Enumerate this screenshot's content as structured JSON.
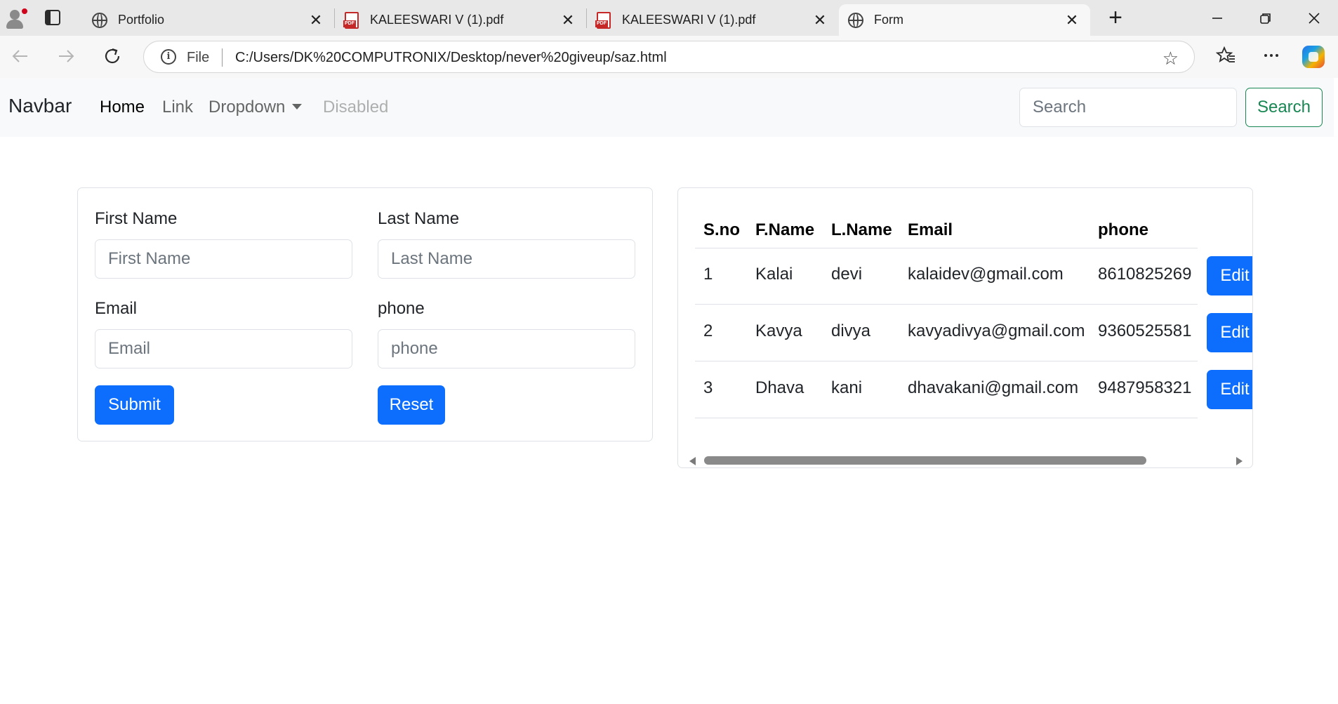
{
  "browser": {
    "tabs": [
      {
        "title": "Portfolio",
        "icon": "globe-icon"
      },
      {
        "title": "KALEESWARI V (1).pdf",
        "icon": "pdf-icon"
      },
      {
        "title": "KALEESWARI V (1).pdf",
        "icon": "pdf-icon"
      },
      {
        "title": "Form",
        "icon": "globe-icon",
        "active": true
      }
    ],
    "close_glyph": "✕",
    "new_tab_glyph": "+",
    "address": {
      "scheme_label": "File",
      "url": "C:/Users/DK%20COMPUTRONIX/Desktop/never%20giveup/saz.html"
    }
  },
  "navbar": {
    "brand": "Navbar",
    "links": [
      {
        "label": "Home",
        "state": "active"
      },
      {
        "label": "Link",
        "state": "normal"
      },
      {
        "label": "Dropdown",
        "state": "dropdown"
      },
      {
        "label": "Disabled",
        "state": "disabled"
      }
    ],
    "search_placeholder": "Search",
    "search_button": "Search",
    "search_button_color": "#198754"
  },
  "form": {
    "first_name_label": "First Name",
    "first_name_placeholder": "First Name",
    "last_name_label": "Last Name",
    "last_name_placeholder": "Last Name",
    "email_label": "Email",
    "email_placeholder": "Email",
    "phone_label": "phone",
    "phone_placeholder": "phone",
    "submit_label": "Submit",
    "reset_label": "Reset",
    "primary_color": "#0d6efd"
  },
  "table": {
    "headers": [
      "S.no",
      "F.Name",
      "L.Name",
      "Email",
      "phone"
    ],
    "rows": [
      {
        "sno": "1",
        "fname": "Kalai",
        "lname": "devi",
        "email": "kalaidev@gmail.com",
        "phone": "8610825269",
        "action": "Edit"
      },
      {
        "sno": "2",
        "fname": "Kavya",
        "lname": "divya",
        "email": "kavyadivya@gmail.com",
        "phone": "9360525581",
        "action": "Edit"
      },
      {
        "sno": "3",
        "fname": "Dhava",
        "lname": "kani",
        "email": "dhavakani@gmail.com",
        "phone": "9487958321",
        "action": "Edit"
      }
    ]
  }
}
